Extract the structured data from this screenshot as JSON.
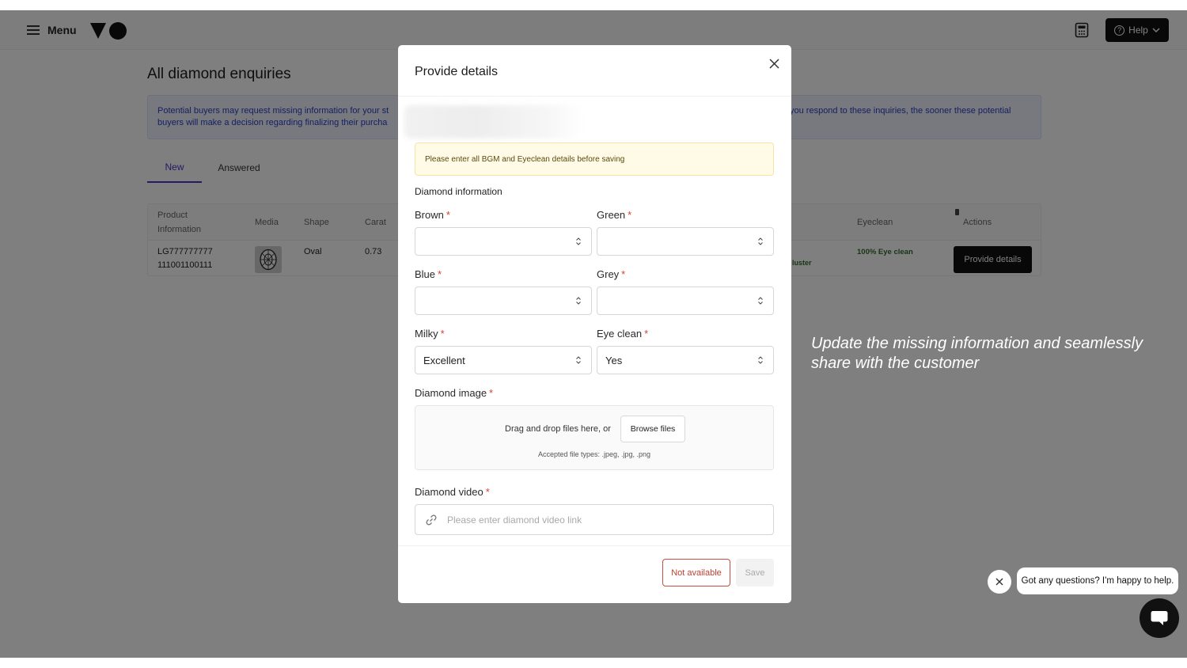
{
  "topbar": {
    "menu_label": "Menu",
    "help_label": "Help"
  },
  "page": {
    "title": "All diamond enquiries",
    "notice_line1": "Potential buyers may request missing information for your st",
    "notice_line2": "buyers will make a decision regarding finalizing their purcha",
    "notice_right": "you respond to these inquiries, the sooner these potential",
    "tabs": [
      {
        "label": "New"
      },
      {
        "label": "Answered"
      }
    ],
    "table": {
      "headers": {
        "product_line1": "Product",
        "product_line2": "Information",
        "media": "Media",
        "shape": "Shape",
        "carat": "Carat",
        "eyeclean": "Eyeclean",
        "actions": "Actions"
      },
      "row": {
        "product_line1": "LG777777777",
        "product_line2": "111001100111",
        "shape": "Oval",
        "carat": "0.73",
        "luster_fragment": "luster",
        "eyeclean": "100% Eye clean",
        "action_label": "Provide details"
      }
    }
  },
  "caption": "Update the missing information and seamlessly share with the customer",
  "modal": {
    "title": "Provide details",
    "warning": "Please enter all BGM and Eyeclean details before saving",
    "section_title": "Diamond information",
    "fields": {
      "brown": {
        "label": "Brown",
        "value": ""
      },
      "green": {
        "label": "Green",
        "value": ""
      },
      "blue": {
        "label": "Blue",
        "value": ""
      },
      "grey": {
        "label": "Grey",
        "value": ""
      },
      "milky": {
        "label": "Milky",
        "value": "Excellent"
      },
      "eye_clean": {
        "label": "Eye clean",
        "value": "Yes"
      }
    },
    "required_mark": "*",
    "image": {
      "label": "Diamond image",
      "drop_text": "Drag and drop files here, or",
      "browse_label": "Browse files",
      "accepted_types": "Accepted file types: .jpeg, .jpg, .png"
    },
    "video": {
      "label": "Diamond video",
      "placeholder": "Please enter diamond video link",
      "value": ""
    },
    "not_available_label": "Not available",
    "save_label": "Save"
  },
  "chat": {
    "message": "Got any questions? I'm happy to help."
  },
  "colors": {
    "accent": "#4a33c8",
    "primary_button": "#111111",
    "required": "#d2452d",
    "warning_bg": "#fffbe6",
    "danger": "#c23e30"
  }
}
